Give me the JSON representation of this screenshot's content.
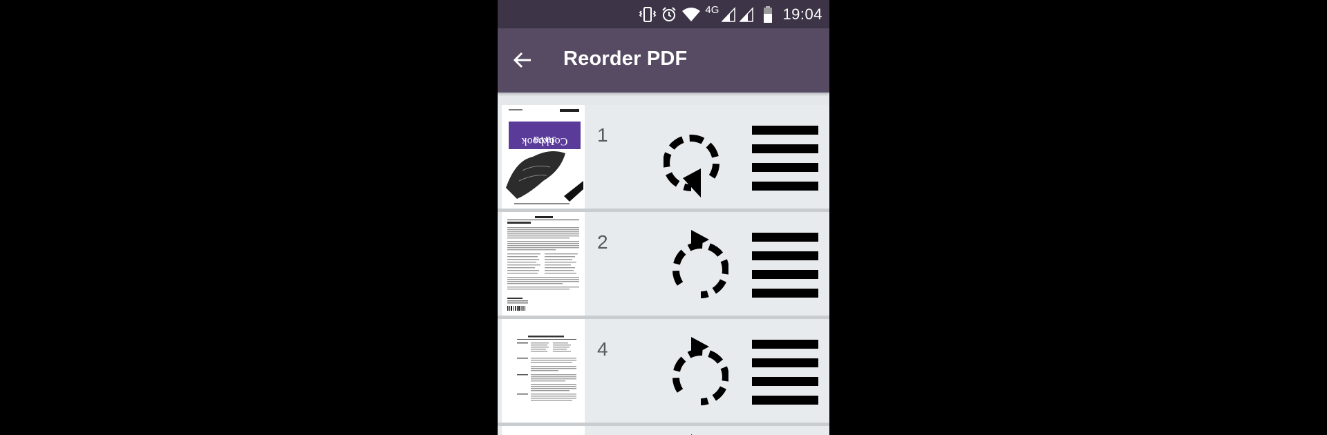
{
  "status_bar": {
    "network": "4G",
    "time": "19:04",
    "icons": [
      "vibrate-icon",
      "alarm-icon",
      "wifi-icon",
      "signal-icon",
      "signal-icon",
      "battery-icon"
    ]
  },
  "app_bar": {
    "title": "Reorder PDF",
    "back_icon": "arrow-left-icon"
  },
  "pages": [
    {
      "number": "1",
      "thumbnail": "cover-page-upside-down",
      "rotate_icon": "rotate-ccw-icon"
    },
    {
      "number": "2",
      "thumbnail": "text-page",
      "rotate_icon": "rotate-cw-icon"
    },
    {
      "number": "4",
      "thumbnail": "contents-page",
      "rotate_icon": "rotate-cw-icon"
    }
  ],
  "colors": {
    "status_bar": "#3d3547",
    "app_bar": "#574b63",
    "list_background": "#e8ebed",
    "cover_accent": "#5a3b9a"
  }
}
